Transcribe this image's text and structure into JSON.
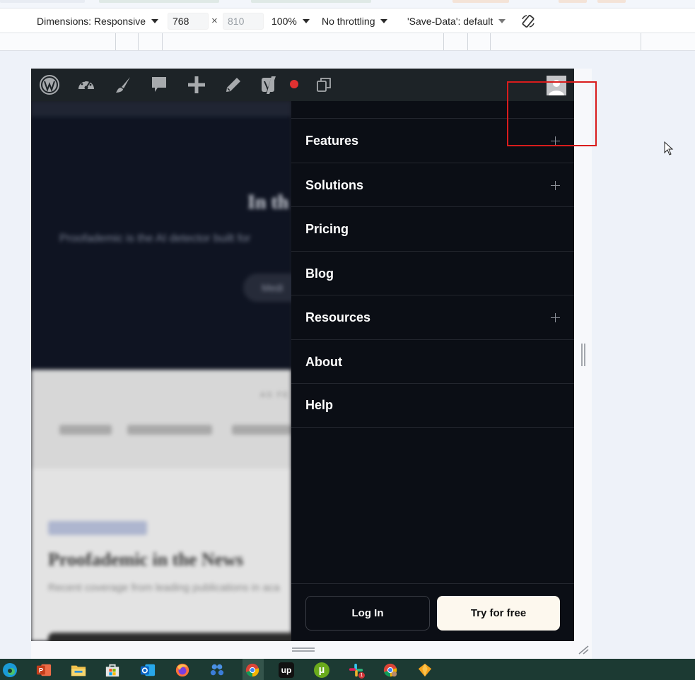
{
  "devtools": {
    "dimensions_label": "Dimensions: Responsive",
    "width_value": "768",
    "height_placeholder": "810",
    "times_sign": "×",
    "zoom": "100%",
    "throttling": "No throttling",
    "save_data": "'Save-Data': default"
  },
  "admin_bar": {
    "icons": [
      "wordpress-icon",
      "dashboard-icon",
      "customize-brush-icon",
      "comments-icon",
      "new-content-icon",
      "edit-pencil-icon",
      "yoast-icon",
      "recording-dot-icon",
      "duplicate-page-icon",
      "user-avatar-icon"
    ]
  },
  "menu": {
    "items": [
      {
        "label": "Features",
        "expandable": true
      },
      {
        "label": "Solutions",
        "expandable": true
      },
      {
        "label": "Pricing",
        "expandable": false
      },
      {
        "label": "Blog",
        "expandable": false
      },
      {
        "label": "Resources",
        "expandable": true
      },
      {
        "label": "About",
        "expandable": false
      },
      {
        "label": "Help",
        "expandable": false
      }
    ],
    "login_label": "Log In",
    "try_label": "Try for free"
  },
  "background_page": {
    "hero_title": "In th",
    "hero_text": "Proofademic is the AI detector built for",
    "hero_button": "Medi",
    "trusted_label": "AS FE",
    "press_title": "Proofademic in the News",
    "press_subtitle": "Recent coverage from leading publications in aca"
  },
  "colors": {
    "drawer_bg": "#0b0e15",
    "admin_bar_bg": "#1d2327",
    "try_button_bg": "#fdf8ee",
    "highlight_box": "#d91c1c",
    "taskbar_bg": "#1c3a33"
  },
  "taskbar": {
    "apps": [
      "edge-icon",
      "powerpoint-icon",
      "file-explorer-icon",
      "microsoft-store-icon",
      "outlook-icon",
      "firefox-icon",
      "bluesky-app-icon",
      "chrome-icon",
      "upwork-icon",
      "utorrent-icon",
      "slack-icon",
      "chrome-profile-icon",
      "sketch-icon"
    ],
    "upwork_label": "up",
    "utorrent_label": "µ",
    "slack_badge": "1"
  }
}
